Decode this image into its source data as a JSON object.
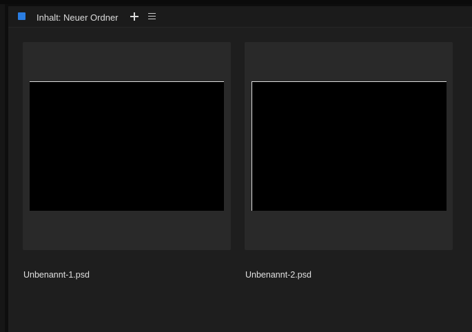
{
  "panel": {
    "title": "Inhalt: Neuer Ordner",
    "label_color": "#2a7de1",
    "actions": {
      "add_icon": "plus-icon",
      "menu_icon": "hamburger-menu-icon"
    }
  },
  "items": [
    {
      "name": "Unbenannt-1.psd"
    },
    {
      "name": "Unbenannt-2.psd"
    }
  ]
}
